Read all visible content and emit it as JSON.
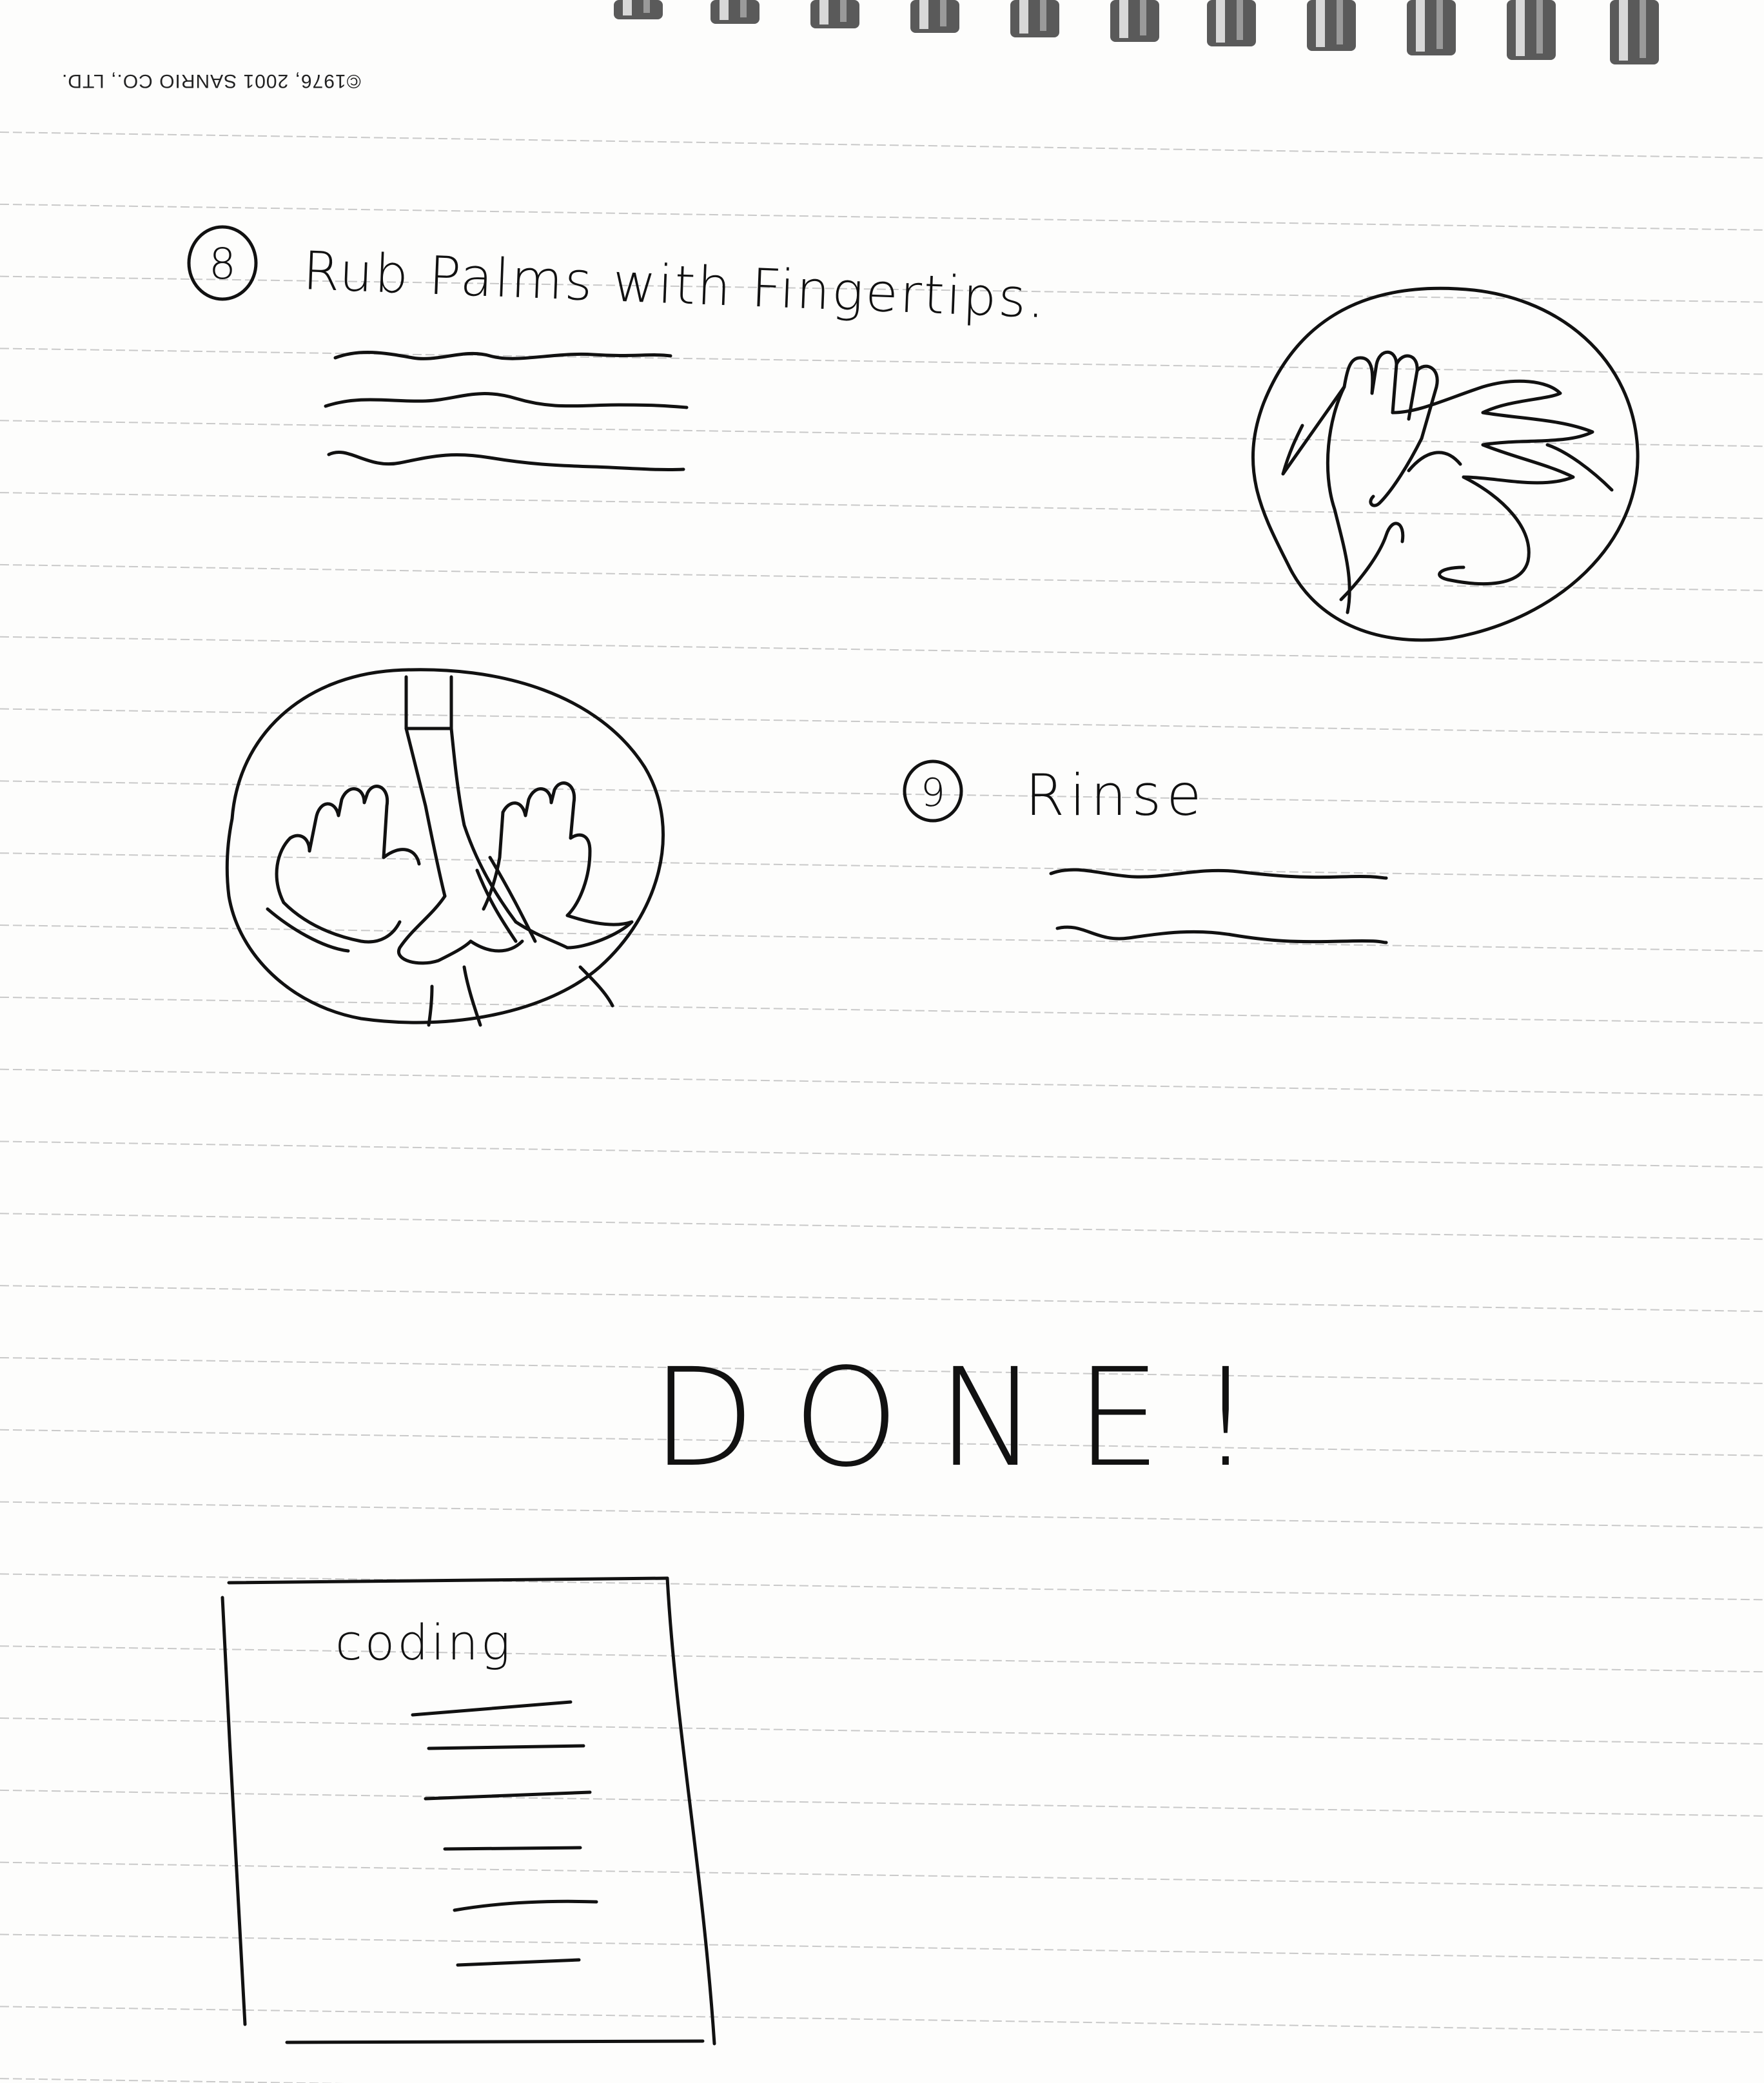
{
  "page": {
    "copyright": "©1976, 2001 SANRIO CO., LTD."
  },
  "step8": {
    "number": "8",
    "title": "Rub Palms with Fingertips."
  },
  "step9": {
    "number": "9",
    "title": "Rinse"
  },
  "finish": {
    "text": "DONE!"
  },
  "coding_box": {
    "label": "coding"
  },
  "icons": [
    "spiral-binding-icon",
    "hands-rubbing-icon",
    "hands-rinsing-icon"
  ],
  "colors": {
    "ink": "#111111",
    "paper": "#fdfdfc",
    "rule": "#c9c9c9"
  }
}
